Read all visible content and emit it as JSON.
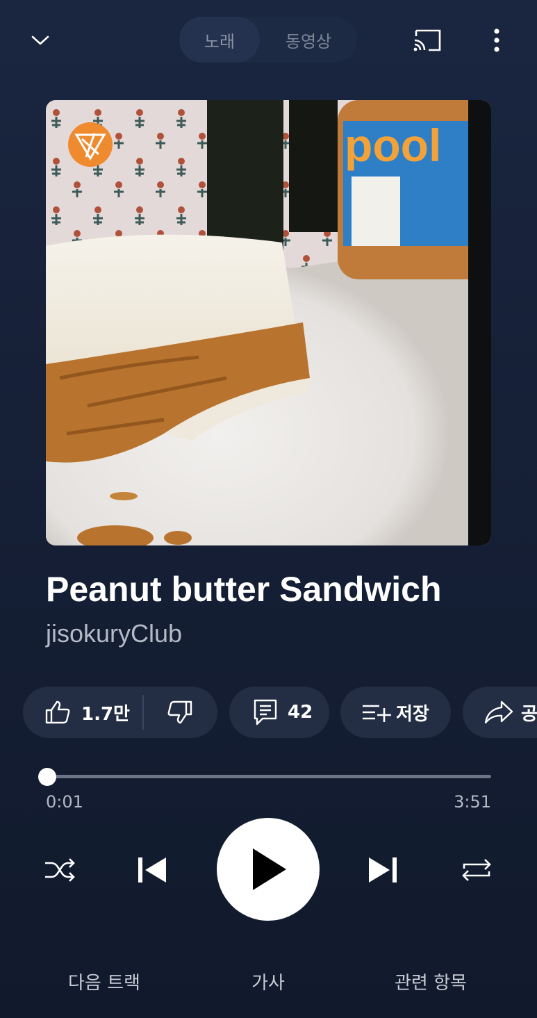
{
  "header": {
    "tabs": [
      "노래",
      "동영상"
    ],
    "active_tab": "노래"
  },
  "song": {
    "title": "Peanut butter Sandwich",
    "artist": "jisokuryClub"
  },
  "artwork": {
    "jar_label": "pool"
  },
  "actions": {
    "likes": "1.7만",
    "comments": "42",
    "save_label": "저장",
    "share_label": "공유"
  },
  "playback": {
    "current_time": "0:01",
    "total_time": "3:51",
    "progress_fraction": 0.0
  },
  "bottom_tabs": [
    "다음 트랙",
    "가사",
    "관련 항목"
  ],
  "colors": {
    "background": "#162037",
    "chip": "#232e45",
    "accent_white": "#ffffff"
  }
}
